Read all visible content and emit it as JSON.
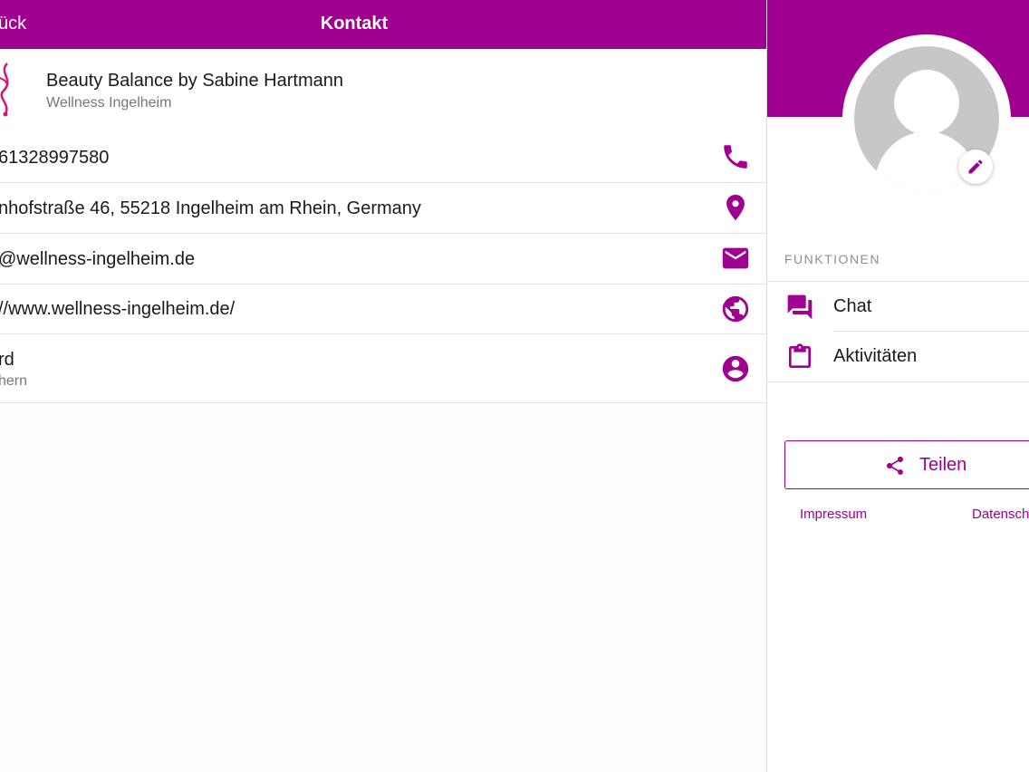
{
  "navbar": {
    "back_label": "ück",
    "title": "Kontakt"
  },
  "business": {
    "name": "Beauty Balance by Sabine Hartmann",
    "subtitle": "Wellness Ingelheim"
  },
  "contact_rows": [
    {
      "text": "61328997580",
      "icon": "phone-icon"
    },
    {
      "text": "nhofstraße 46, 55218 Ingelheim am Rhein, Germany",
      "icon": "location-pin-icon"
    },
    {
      "text": "@wellness-ingelheim.de",
      "icon": "mail-icon"
    },
    {
      "text": "//www.wellness-ingelheim.de/",
      "icon": "globe-icon"
    },
    {
      "text": "rd",
      "subtext": "hern",
      "icon": "account-circle-icon"
    }
  ],
  "sidebar": {
    "section_label": "FUNKTIONEN",
    "functions": [
      {
        "label": "Chat",
        "icon": "chat-icon"
      },
      {
        "label": "Aktivitäten",
        "icon": "clipboard-icon"
      }
    ],
    "share_label": "Teilen",
    "links": {
      "imprint": "Impressum",
      "privacy": "Datensch"
    }
  },
  "colors": {
    "accent": "#a0008f",
    "avatar_gray": "#c7c7c7",
    "divider": "#e2e2e2"
  }
}
